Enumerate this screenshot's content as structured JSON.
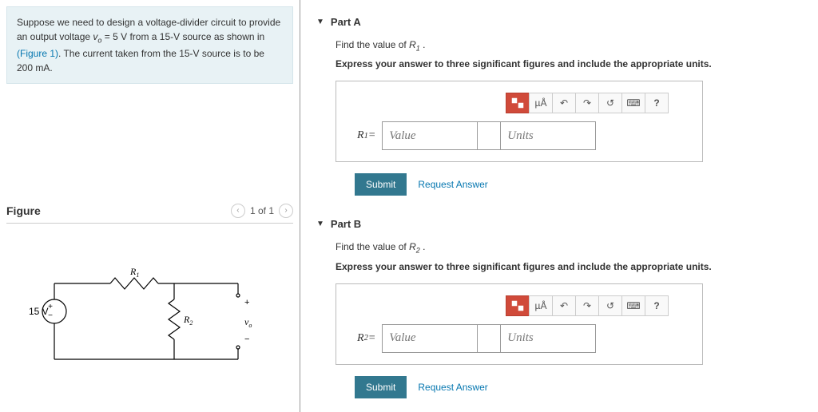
{
  "problem": {
    "text1": "Suppose we need to design a voltage-divider circuit to provide an output voltage ",
    "vo": "v",
    "vo_sub": "o",
    "vo_eq": " = 5 V from a 15-V source as shown in ",
    "figlink": "(Figure 1)",
    "text2": ". The current taken from the 15-V source is to be 200 mA."
  },
  "figure": {
    "title": "Figure",
    "counter": "1 of 1",
    "source_label": "15 V",
    "r1_label": "R",
    "r1_sub": "1",
    "r2_label": "R",
    "r2_sub": "2",
    "vo_label": "v",
    "vo_sub": "o",
    "plus": "+",
    "minus": "−"
  },
  "partA": {
    "title": "Part A",
    "find": "Find the value of ",
    "var": "R",
    "varsub": "1",
    "period": " .",
    "express": "Express your answer to three significant figures and include the appropriate units.",
    "eq_label": "R",
    "eq_sub": "1",
    "eq_sign": " = ",
    "value_ph": "Value",
    "units_ph": "Units",
    "submit": "Submit",
    "request": "Request Answer",
    "tb_mu": "µÅ",
    "tb_q": "?"
  },
  "partB": {
    "title": "Part B",
    "find": "Find the value of ",
    "var": "R",
    "varsub": "2",
    "period": " .",
    "express": "Express your answer to three significant figures and include the appropriate units.",
    "eq_label": "R",
    "eq_sub": "2",
    "eq_sign": " = ",
    "value_ph": "Value",
    "units_ph": "Units",
    "submit": "Submit",
    "request": "Request Answer",
    "tb_mu": "µÅ",
    "tb_q": "?"
  }
}
